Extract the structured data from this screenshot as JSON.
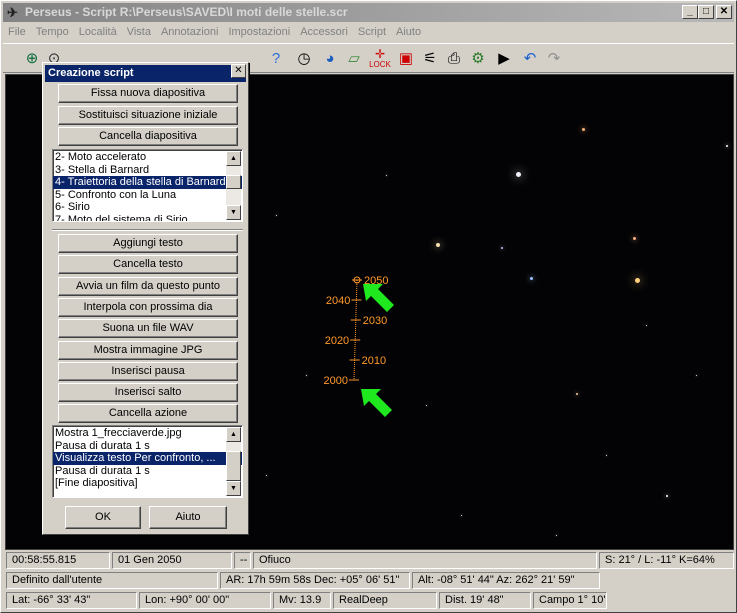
{
  "window": {
    "title": "Perseus - Script R:\\Perseus\\SAVED\\I moti delle stelle.scr"
  },
  "menu": [
    "File",
    "Tempo",
    "Località",
    "Vista",
    "Annotazioni",
    "Impostazioni",
    "Accessori",
    "Script",
    "Aiuto"
  ],
  "toolbar": {
    "lock_label": "LOCK"
  },
  "dialog": {
    "title": "Creazione script",
    "top_buttons": [
      "Fissa nuova diapositiva",
      "Sostituisci situazione iniziale",
      "Cancella diapositiva"
    ],
    "slides": [
      "2- Moto accelerato",
      "3- Stella di Barnard",
      "4- Traiettoria della stella di Barnard",
      "5- Confronto con la Luna",
      "6- Sirio",
      "7- Moto del sistema di Sirio"
    ],
    "selected_slide": 2,
    "action_buttons": [
      "Aggiungi testo",
      "Cancella testo",
      "Avvia un film da questo punto",
      "Interpola con prossima dia",
      "Suona un file WAV",
      "Mostra immagine JPG",
      "Inserisci pausa",
      "Inserisci salto",
      "Cancella azione"
    ],
    "actions": [
      "Mostra 1_frecciaverde.jpg",
      "Pausa di durata 1 s",
      "Visualizza testo Per confronto, ...",
      "Pausa di durata 1 s",
      "[Fine diapositiva]"
    ],
    "selected_action": 2,
    "ok_label": "OK",
    "help_label": "Aiuto"
  },
  "trajectory": {
    "labels": [
      {
        "text": "2050",
        "side": "right"
      },
      {
        "text": "2040",
        "side": "left"
      },
      {
        "text": "2030",
        "side": "right"
      },
      {
        "text": "2020",
        "side": "left"
      },
      {
        "text": "2010",
        "side": "right"
      },
      {
        "text": "2000",
        "side": "left"
      }
    ],
    "color": "#ff9a2a",
    "arrow_color": "#1fe81f"
  },
  "status": {
    "row1": [
      "00:58:55.815",
      "01 Gen 2050",
      "--",
      "Ofiuco",
      "S: 21° / L: -11° K=64%"
    ],
    "row2": [
      "Definito dall'utente",
      "AR: 17h 59m 58s   Dec: +05° 06' 51\"",
      "Alt: -08° 51' 44\"  Az: 262° 21' 59\""
    ],
    "row3": [
      "Lat: -66° 33' 43\"",
      "Lon: +90° 00' 00\"",
      "Mv: 13.9",
      "RealDeep",
      "Dist. 19' 48\"",
      "Campo 1° 10'"
    ]
  }
}
